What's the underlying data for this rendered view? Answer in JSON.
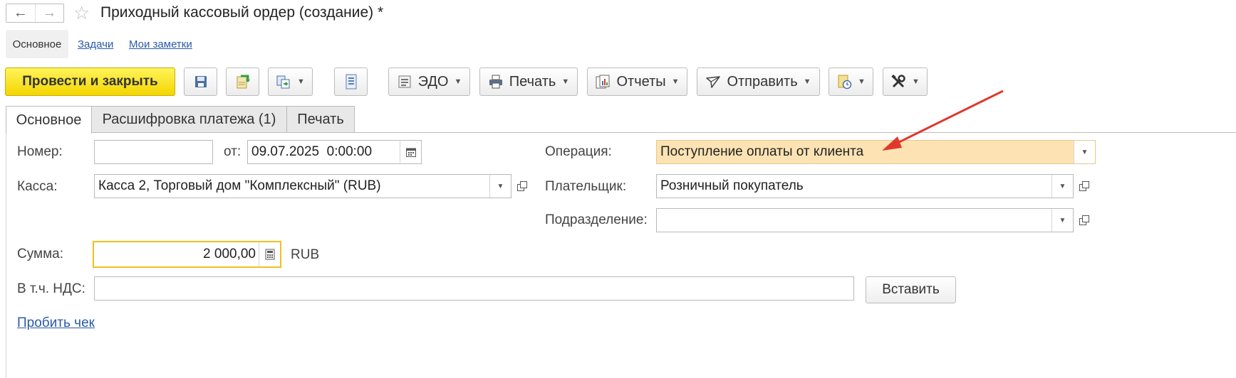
{
  "window": {
    "title": "Приходный кассовый ордер (создание) *"
  },
  "sections": {
    "main": "Основное",
    "tasks": "Задачи",
    "notes": "Мои заметки"
  },
  "toolbar": {
    "post_close": "Провести и закрыть",
    "edo": "ЭДО",
    "print": "Печать",
    "reports": "Отчеты",
    "send": "Отправить"
  },
  "tabs": [
    {
      "label": "Основное",
      "active": true
    },
    {
      "label": "Расшифровка платежа (1)",
      "active": false
    },
    {
      "label": "Печать",
      "active": false
    }
  ],
  "form": {
    "number_label": "Номер:",
    "number_value": "",
    "from_label": "от:",
    "date_value": "09.07.2025  0:00:00",
    "kassa_label": "Касса:",
    "kassa_value": "Касса 2, Торговый дом \"Комплексный\" (RUB)",
    "operation_label": "Операция:",
    "operation_value": "Поступление оплаты от клиента",
    "payer_label": "Плательщик:",
    "payer_value": "Розничный покупатель",
    "division_label": "Подразделение:",
    "division_value": "",
    "sum_label": "Сумма:",
    "sum_value": "2 000,00",
    "currency": "RUB",
    "vat_label": "В т.ч. НДС:",
    "vat_value": "",
    "insert_button": "Вставить",
    "receipt_link": "Пробить чек"
  },
  "colors": {
    "primary_button": "#f4d500",
    "operation_highlight": "#fde3b3",
    "link": "#2a5aa8",
    "annotation_arrow": "#e0392b"
  }
}
